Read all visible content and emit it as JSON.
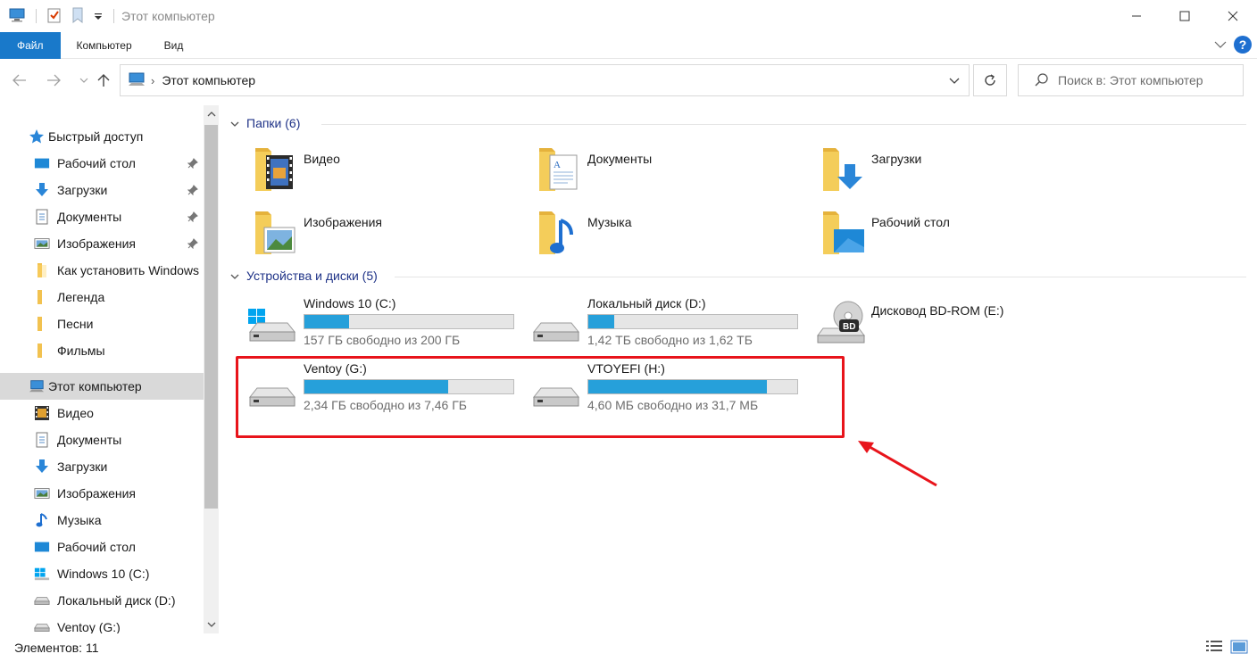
{
  "window": {
    "title": "Этот компьютер"
  },
  "ribbon": {
    "tabs": [
      "Файл",
      "Компьютер",
      "Вид"
    ]
  },
  "address": {
    "path": "Этот компьютер",
    "search_placeholder": "Поиск в: Этот компьютер"
  },
  "sidebar": {
    "items": [
      {
        "label": "Быстрый доступ",
        "icon": "star-icon"
      },
      {
        "label": "Рабочий стол",
        "icon": "desktop-icon",
        "pinned": true
      },
      {
        "label": "Загрузки",
        "icon": "downloads-icon",
        "pinned": true
      },
      {
        "label": "Документы",
        "icon": "documents-icon",
        "pinned": true
      },
      {
        "label": "Изображения",
        "icon": "pictures-icon",
        "pinned": true
      },
      {
        "label": "Как установить Windows",
        "icon": "folder-icon"
      },
      {
        "label": "Легенда",
        "icon": "folder-icon"
      },
      {
        "label": "Песни",
        "icon": "folder-icon"
      },
      {
        "label": "Фильмы",
        "icon": "folder-icon"
      },
      {
        "label": "Этот компьютер",
        "icon": "computer-icon",
        "selected": true
      },
      {
        "label": "Видео",
        "icon": "video-icon"
      },
      {
        "label": "Документы",
        "icon": "documents-icon"
      },
      {
        "label": "Загрузки",
        "icon": "downloads-icon"
      },
      {
        "label": "Изображения",
        "icon": "pictures-icon"
      },
      {
        "label": "Музыка",
        "icon": "music-icon"
      },
      {
        "label": "Рабочий стол",
        "icon": "desktop-icon"
      },
      {
        "label": "Windows 10 (C:)",
        "icon": "windows-drive-icon"
      },
      {
        "label": "Локальный диск (D:)",
        "icon": "drive-icon"
      },
      {
        "label": "Ventoy (G:)",
        "icon": "drive-icon"
      }
    ]
  },
  "content": {
    "folders_header": "Папки (6)",
    "folders": [
      {
        "name": "Видео",
        "icon": "video-folder-icon"
      },
      {
        "name": "Документы",
        "icon": "documents-folder-icon"
      },
      {
        "name": "Загрузки",
        "icon": "downloads-folder-icon"
      },
      {
        "name": "Изображения",
        "icon": "pictures-folder-icon"
      },
      {
        "name": "Музыка",
        "icon": "music-folder-icon"
      },
      {
        "name": "Рабочий стол",
        "icon": "desktop-folder-icon"
      }
    ],
    "drives_header": "Устройства и диски (5)",
    "drives": [
      {
        "name": "Windows 10 (C:)",
        "free_text": "157 ГБ свободно из 200 ГБ",
        "used_fraction": 0.215,
        "icon": "windows-drive-icon"
      },
      {
        "name": "Локальный диск (D:)",
        "free_text": "1,42 ТБ свободно из 1,62 ТБ",
        "used_fraction": 0.123,
        "icon": "drive-icon"
      },
      {
        "name": "Дисковод BD-ROM (E:)",
        "icon": "bd-rom-icon"
      },
      {
        "name": "Ventoy (G:)",
        "free_text": "2,34 ГБ свободно из 7,46 ГБ",
        "used_fraction": 0.686,
        "icon": "drive-icon"
      },
      {
        "name": "VTOYEFI (H:)",
        "free_text": "4,60 МБ свободно из 31,7 МБ",
        "used_fraction": 0.855,
        "icon": "drive-icon"
      }
    ]
  },
  "status": {
    "count": "Элементов: 11"
  },
  "colors": {
    "accent": "#1979ca",
    "bar_fill": "#26a0da",
    "highlight": "#e8141b",
    "group_header": "#1e3287"
  }
}
